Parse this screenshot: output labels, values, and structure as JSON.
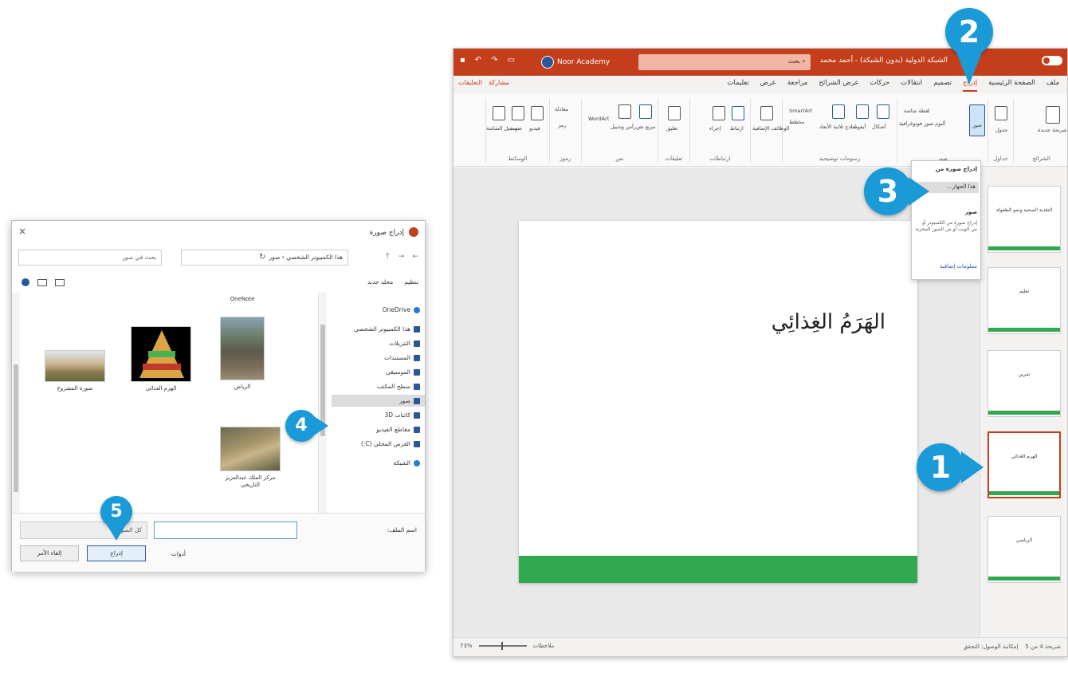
{
  "ppt": {
    "doc_title": "الشبكة الدولية (بدون الشبكة) - أحمد محمد",
    "search": "بحث",
    "account": "Noor Academy",
    "tabs": [
      "ملف",
      "الصفحة الرئيسية",
      "إدراج",
      "تصميم",
      "انتقالات",
      "حركات",
      "عرض الشرائح",
      "مراجعة",
      "عرض",
      "تعليمات"
    ],
    "active_tab": "إدراج",
    "share": "مشاركة",
    "comments": "التعليقات",
    "ribbon": {
      "new_slide": "شريحة جديدة",
      "table": "جدول",
      "images": "صور",
      "screenshot": "لقطة شاشة",
      "photo_album": "ألبوم صور فوتوغرافية",
      "shapes": "أشكال",
      "icons": "أيقونات",
      "models_3d": "نماذج ثلاثية الأبعاد",
      "smartart": "SmartArt",
      "chart": "مخطط",
      "addins": "الوظائف الإضافية",
      "link": "ارتباط",
      "action": "إجراء",
      "comment": "تعليق",
      "textbox": "مربع نص",
      "header_footer": "رأس وتذييل",
      "wordart": "WordArt",
      "equation": "معادلة",
      "symbol": "رمز",
      "video": "فيديو",
      "audio": "صوت",
      "screen_recording": "تسجيل الشاشة",
      "group_slides": "الشرائح",
      "group_tables": "جداول",
      "group_images": "صور",
      "group_illustrations": "رسومات توضيحية",
      "group_links": "ارتباطات",
      "group_comments": "تعليقات",
      "group_text": "نص",
      "group_symbols": "رموز",
      "group_media": "الوسائط"
    },
    "image_menu": {
      "header": "إدراج صورة من",
      "device": "هذا الجهاز...",
      "hint_title": "صور",
      "hint": "إدراج صورة من الكمبيوتر أو من الويب أو من الصور المخزنة",
      "more": "معلومات إضافية"
    },
    "slide_title": "الهَرَمُ الغِذائِي",
    "thumbnails": [
      {
        "text": "التغذية الصحية ونمو الطفولة"
      },
      {
        "text": "تعليم"
      },
      {
        "text": "تمرين"
      },
      {
        "text": "الهرم الغذائي"
      },
      {
        "text": "الرياضي"
      }
    ],
    "status_right": "شريحة 4 من 5",
    "status_accessibility": "إمكانية الوصول: التحقق",
    "status_notes": "ملاحظات",
    "zoom": "73%"
  },
  "dialog": {
    "title": "إدراج صورة",
    "close": "×",
    "address": "هذا الكمبيوتر الشخصي › صور",
    "search_placeholder": "بحث في صور",
    "organize": "تنظيم",
    "new_folder": "مجلد جديد",
    "nav_items": [
      {
        "label": "OneDrive",
        "icon": "cloud-icon"
      },
      {
        "label": "هذا الكمبيوتر الشخصي",
        "icon": "computer-icon"
      },
      {
        "label": "التنزيلات",
        "icon": "download-icon"
      },
      {
        "label": "المستندات",
        "icon": "document-icon"
      },
      {
        "label": "الموسيقى",
        "icon": "music-icon"
      },
      {
        "label": "سطح المكتب",
        "icon": "desktop-icon"
      },
      {
        "label": "صور",
        "icon": "pictures-icon"
      },
      {
        "label": "كائنات 3D",
        "icon": "cube-icon"
      },
      {
        "label": "مقاطع الفيديو",
        "icon": "video-icon"
      },
      {
        "label": "القرص المحلي (C:)",
        "icon": "drive-icon"
      },
      {
        "label": "الشبكة",
        "icon": "network-icon"
      }
    ],
    "selected_nav": "صور",
    "top_folder": "OneNote",
    "files": [
      {
        "name": "الرياض"
      },
      {
        "name": "الهرم الغذائي"
      },
      {
        "name": "صورة المشروع"
      },
      {
        "name": "مركز الملك عبدالعزيز التاريخي"
      }
    ],
    "filename_label": "اسم الملف:",
    "filename_value": "",
    "filetype": "كل الصور",
    "tools": "أدوات",
    "insert": "إدراج",
    "cancel": "إلغاء الأمر"
  },
  "callouts": [
    "1",
    "2",
    "3",
    "4",
    "5"
  ],
  "colors": {
    "ppt_accent": "#c43e1c",
    "callout_blue": "#1a9ad6",
    "slide_green": "#2fa84f"
  }
}
